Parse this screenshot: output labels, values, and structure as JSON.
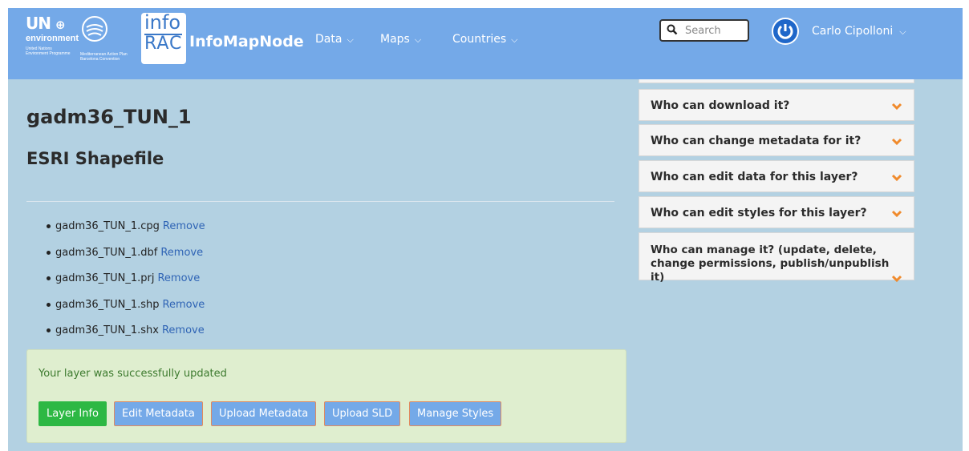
{
  "navbar": {
    "logo_un": {
      "main": "UN",
      "sub": "environment",
      "caption": "United Nations Environment Programme"
    },
    "logo_map": {
      "caption": "Mediterranean Action Plan Barcelona Convention"
    },
    "logo_info": {
      "top": "info",
      "bottom": "RAC"
    },
    "brand": "InfoMapNode",
    "menu": [
      {
        "label": "Data"
      },
      {
        "label": "Maps"
      },
      {
        "label": "Countries"
      }
    ],
    "search_placeholder": "Search",
    "user": "Carlo Cipolloni"
  },
  "main": {
    "title": "gadm36_TUN_1",
    "subtitle": "ESRI Shapefile",
    "files": [
      {
        "name": "gadm36_TUN_1.cpg",
        "action": "Remove"
      },
      {
        "name": "gadm36_TUN_1.dbf",
        "action": "Remove"
      },
      {
        "name": "gadm36_TUN_1.prj",
        "action": "Remove"
      },
      {
        "name": "gadm36_TUN_1.shp",
        "action": "Remove"
      },
      {
        "name": "gadm36_TUN_1.shx",
        "action": "Remove"
      }
    ],
    "alert": {
      "message": "Your layer was successfully updated",
      "buttons": [
        "Layer Info",
        "Edit Metadata",
        "Upload Metadata",
        "Upload SLD",
        "Manage Styles"
      ]
    }
  },
  "permissions": {
    "items": [
      {
        "question": "Who can download it?"
      },
      {
        "question": "Who can change metadata for it?"
      },
      {
        "question": "Who can edit data for this layer?"
      },
      {
        "question": "Who can edit styles for this layer?"
      },
      {
        "question": "Who can manage it? (update, delete, change permissions, publish/unpublish it)"
      }
    ]
  },
  "colors": {
    "navbar": "#74a9e8",
    "content_bg": "#b3d1e2",
    "chevron": "#f08a2c",
    "success_text": "#3c7a2e",
    "link": "#2f64b5"
  }
}
